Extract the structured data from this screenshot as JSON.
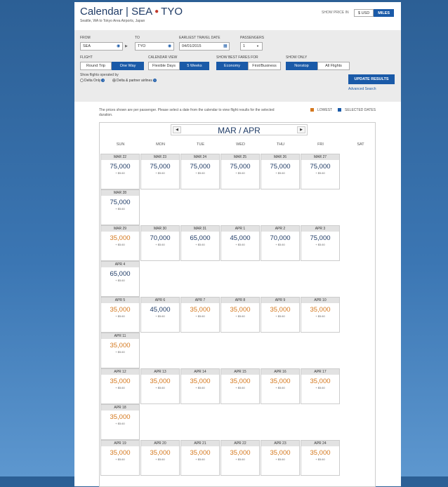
{
  "header": {
    "title_city_from": "Calendar | SEA",
    "title_city_to": "TYO",
    "subtitle": "Seattle, WA to Tokyo Area Airports, Japan",
    "show_price_in": "SHOW PRICE IN",
    "currency_options": [
      "$ USD",
      "MILES"
    ]
  },
  "search": {
    "from_label": "FROM",
    "from_value": "SEA",
    "to_label": "TO",
    "to_value": "TYO",
    "date_label": "EARLIEST TRAVEL DATE",
    "date_value": "04/01/2015",
    "passengers_label": "PASSENGERS",
    "passengers_value": "1",
    "flight_label": "FLIGHT",
    "flight_options": [
      "Round Trip",
      "One Way"
    ],
    "calview_label": "CALENDAR VIEW",
    "calview_options": [
      "Flexible Days",
      "5 Weeks"
    ],
    "fares_label": "SHOW BEST FARES FOR",
    "fares_options": [
      "Economy",
      "First/Business"
    ],
    "showonly_label": "SHOW ONLY",
    "showonly_options": [
      "Nonstop",
      "All Flights"
    ],
    "operated_label": "Show flights operated by",
    "operated_options": [
      "Delta Only",
      "Delta & partner airlines"
    ],
    "update_button": "UPDATE RESULTS",
    "advanced_link": "Advanced Search"
  },
  "calendar": {
    "note": "The prices shown are per passenger. Please select a date from the calendar to view flight results for the selected duration.",
    "legend_lowest": "LOWEST",
    "legend_selected": "SELECTED DATES",
    "lowest_color": "#d4781e",
    "selected_color": "#1a5aa8",
    "prev_icon": "◀",
    "next_icon": "▶",
    "month_title": "MAR / APR",
    "weekdays": [
      "SUN",
      "MON",
      "TUE",
      "WED",
      "THU",
      "FRI",
      "SAT"
    ],
    "tax": "+ $5.60",
    "weeks": [
      {
        "days": [
          {
            "date": "MAR 22",
            "miles": "75,000",
            "lowest": false
          },
          {
            "date": "MAR 23",
            "miles": "75,000",
            "lowest": false
          },
          {
            "date": "MAR 24",
            "miles": "75,000",
            "lowest": false
          },
          {
            "date": "MAR 25",
            "miles": "75,000",
            "lowest": false
          },
          {
            "date": "MAR 26",
            "miles": "75,000",
            "lowest": false
          },
          {
            "date": "MAR 27",
            "miles": "75,000",
            "lowest": false
          }
        ],
        "extra": {
          "date": "MAR 28",
          "miles": "75,000",
          "lowest": false
        }
      },
      {
        "days": [
          {
            "date": "MAR 29",
            "miles": "35,000",
            "lowest": true
          },
          {
            "date": "MAR 30",
            "miles": "70,000",
            "lowest": false
          },
          {
            "date": "MAR 31",
            "miles": "65,000",
            "lowest": false
          },
          {
            "date": "APR 1",
            "miles": "45,000",
            "lowest": false
          },
          {
            "date": "APR 2",
            "miles": "70,000",
            "lowest": false
          },
          {
            "date": "APR 3",
            "miles": "75,000",
            "lowest": false
          }
        ],
        "extra": {
          "date": "APR 4",
          "miles": "65,000",
          "lowest": false
        }
      },
      {
        "days": [
          {
            "date": "APR 5",
            "miles": "35,000",
            "lowest": true
          },
          {
            "date": "APR 6",
            "miles": "45,000",
            "lowest": false
          },
          {
            "date": "APR 7",
            "miles": "35,000",
            "lowest": true
          },
          {
            "date": "APR 8",
            "miles": "35,000",
            "lowest": true
          },
          {
            "date": "APR 9",
            "miles": "35,000",
            "lowest": true
          },
          {
            "date": "APR 10",
            "miles": "35,000",
            "lowest": true
          }
        ],
        "extra": {
          "date": "APR 11",
          "miles": "35,000",
          "lowest": true
        }
      },
      {
        "days": [
          {
            "date": "APR 12",
            "miles": "35,000",
            "lowest": true
          },
          {
            "date": "APR 13",
            "miles": "35,000",
            "lowest": true
          },
          {
            "date": "APR 14",
            "miles": "35,000",
            "lowest": true
          },
          {
            "date": "APR 15",
            "miles": "35,000",
            "lowest": true
          },
          {
            "date": "APR 16",
            "miles": "35,000",
            "lowest": true
          },
          {
            "date": "APR 17",
            "miles": "35,000",
            "lowest": true
          }
        ],
        "extra": {
          "date": "APR 18",
          "miles": "35,000",
          "lowest": true
        }
      },
      {
        "days": [
          {
            "date": "APR 19",
            "miles": "35,000",
            "lowest": true
          },
          {
            "date": "APR 20",
            "miles": "35,000",
            "lowest": true
          },
          {
            "date": "APR 21",
            "miles": "35,000",
            "lowest": true
          },
          {
            "date": "APR 22",
            "miles": "35,000",
            "lowest": true
          },
          {
            "date": "APR 23",
            "miles": "35,000",
            "lowest": true
          },
          {
            "date": "APR 24",
            "miles": "35,000",
            "lowest": true
          }
        ]
      }
    ]
  }
}
